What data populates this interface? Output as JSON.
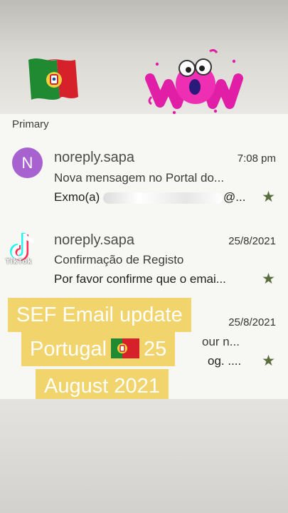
{
  "section": {
    "label": "Primary"
  },
  "emails": [
    {
      "avatar_letter": "N",
      "sender": "noreply.sapa",
      "time": "7:08 pm",
      "subject": "Nova mensagem no Portal do...",
      "snippet_start": "Exmo(a)",
      "snippet_end": "@...",
      "starred": true
    },
    {
      "avatar_letter": "",
      "sender": "noreply.sapa",
      "time": "25/8/2021",
      "subject": "Confirmação de Registo",
      "snippet": "Por favor confirme que o emai...",
      "starred": true
    },
    {
      "time": "25/8/2021",
      "subject_tail": "our n...",
      "snippet_tail": "og. ....",
      "starred": true
    }
  ],
  "watermark": {
    "text": "TikTok"
  },
  "caption": {
    "line1": "SEF Email update",
    "line2_a": "Portugal",
    "line2_b": "25",
    "line3": "August 2021"
  },
  "icons": {
    "star": "star-icon",
    "flag": "portugal-flag-icon",
    "sticker": "wow-sticker",
    "watermark": "tiktok-logo-icon"
  },
  "colors": {
    "avatar": "#a862cf",
    "star": "#596d3e",
    "caption_bg": "#f1d46b"
  }
}
